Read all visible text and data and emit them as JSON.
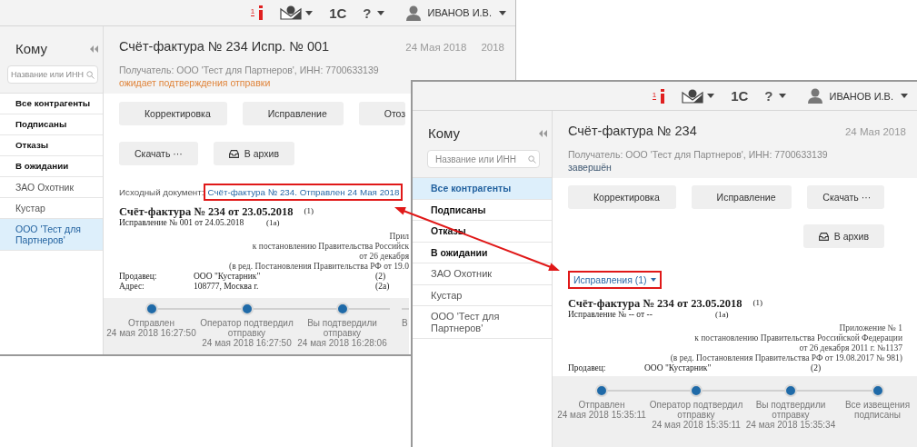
{
  "windows": [
    {
      "topbar": {
        "badge": "1",
        "logo": "1С",
        "help": "?",
        "user": "ИВАНОВ И.В."
      },
      "sidebar": {
        "title": "Кому",
        "search_placeholder": "Название или ИНН",
        "items": [
          {
            "label": "Все контрагенты",
            "bold": true,
            "selected": false
          },
          {
            "label": "Подписаны",
            "bold": true,
            "selected": false
          },
          {
            "label": "Отказы",
            "bold": true,
            "selected": false
          },
          {
            "label": "В ожидании",
            "bold": true,
            "selected": false
          },
          {
            "label": "ЗАО Охотник",
            "bold": false,
            "selected": false
          },
          {
            "label": "Кустар",
            "bold": false,
            "selected": false
          },
          {
            "label": "ООО 'Тест для Партнеров'",
            "bold": false,
            "selected": true
          }
        ]
      },
      "header": {
        "title": "Счёт-фактура № 234 Испр. № 001",
        "dates": [
          "24 Мая 2018",
          "2018"
        ],
        "recipient": "Получатель: ООО 'Тест для Партнеров', ИНН: 7700633139",
        "status": "ожидает подтверждения отправки",
        "completed": false
      },
      "button_rows": [
        {
          "buttons": [
            {
              "label": "Корректировка",
              "kind": "plain"
            },
            {
              "label": "Исправление",
              "kind": "plain"
            },
            {
              "label": "Отоз",
              "kind": "plain"
            }
          ]
        },
        {
          "buttons": [
            {
              "label": "Скачать ···",
              "kind": "plain"
            },
            {
              "label": "В архив",
              "kind": "archive"
            }
          ]
        }
      ],
      "source_document": {
        "label": "Исходный документ:",
        "link": "Счёт-фактура № 234. Отправлен 24 Мая 2018",
        "highlighted": true
      },
      "document": {
        "title": "Счёт-фактура № 234 от 23.05.2018",
        "title_note": "(1)",
        "correction": "Исправление № 001 от 24.05.2018",
        "correction_note": "(1а)",
        "appendix": [
          "Прил",
          "к постановлению Правительства Российск",
          "от 26 декабря",
          "(в ред. Постановления Правительства РФ от 19.0"
        ],
        "fields": [
          {
            "label": "Продавец:",
            "value": "ООО \"Кустарник\"",
            "note": "(2)"
          },
          {
            "label": "Адрес:",
            "value": "108777, Москва г.",
            "note": "(2а)"
          }
        ]
      },
      "timeline": [
        {
          "kind": "full",
          "label": "Отправлен",
          "time": "24 мая 2018 16:27:50"
        },
        {
          "kind": "full",
          "label": "Оператор подтвердил отправку",
          "time": "24 мая 2018 16:27:50"
        },
        {
          "kind": "full",
          "label": "Вы подтвердили отправку",
          "time": "24 мая 2018 16:28:06"
        },
        {
          "kind": "cut",
          "label": "В"
        }
      ]
    },
    {
      "topbar": {
        "badge": "1",
        "logo": "1С",
        "help": "?",
        "user": "ИВАНОВ И.В."
      },
      "sidebar": {
        "title": "Кому",
        "search_placeholder": "Название или ИНН",
        "items": [
          {
            "label": "Все контрагенты",
            "bold": true,
            "selected": true
          },
          {
            "label": "Подписаны",
            "bold": true,
            "selected": false
          },
          {
            "label": "Отказы",
            "bold": true,
            "selected": false
          },
          {
            "label": "В ожидании",
            "bold": true,
            "selected": false
          },
          {
            "label": "ЗАО Охотник",
            "bold": false,
            "selected": false
          },
          {
            "label": "Кустар",
            "bold": false,
            "selected": false
          },
          {
            "label": "ООО 'Тест для Партнеров'",
            "bold": false,
            "selected": false
          }
        ]
      },
      "header": {
        "title": "Счёт-фактура № 234",
        "dates": [
          "24 Мая 2018"
        ],
        "recipient": "Получатель: ООО 'Тест для Партнеров', ИНН: 7700633139",
        "status": "завершён",
        "completed": true
      },
      "button_rows": [
        {
          "buttons": [
            {
              "label": "Корректировка",
              "kind": "plain"
            },
            {
              "label": "Исправление",
              "kind": "plain"
            },
            {
              "label": "Скачать ···",
              "kind": "plain"
            }
          ]
        },
        {
          "buttons": [
            {
              "label": "В архив",
              "kind": "archive"
            }
          ]
        }
      ],
      "corrections": {
        "label": "Исправления (1)",
        "highlighted": true
      },
      "document": {
        "title": "Счёт-фактура № 234 от 23.05.2018",
        "title_note": "(1)",
        "correction": "Исправление № -- от --",
        "correction_note": "(1а)",
        "appendix": [
          "Приложение № 1",
          "к постановлению Правительства Российской Федерации",
          "от 26 декабря 2011 г. №1137",
          "(в ред. Постановления Правительства РФ от 19.08.2017 № 981)"
        ],
        "fields": [
          {
            "label": "Продавец:",
            "value": "ООО \"Кустарник\"",
            "note": "(2)"
          }
        ]
      },
      "timeline": [
        {
          "kind": "full",
          "label": "Отправлен",
          "time": "24 мая 2018 15:35:11"
        },
        {
          "kind": "full",
          "label": "Оператор подтвердил отправку",
          "time": "24 мая 2018 15:35:11"
        },
        {
          "kind": "full",
          "label": "Вы подтвердили отправку",
          "time": "24 мая 2018 15:35:34"
        },
        {
          "kind": "full",
          "label": "Все извещения подписаны"
        }
      ]
    }
  ]
}
